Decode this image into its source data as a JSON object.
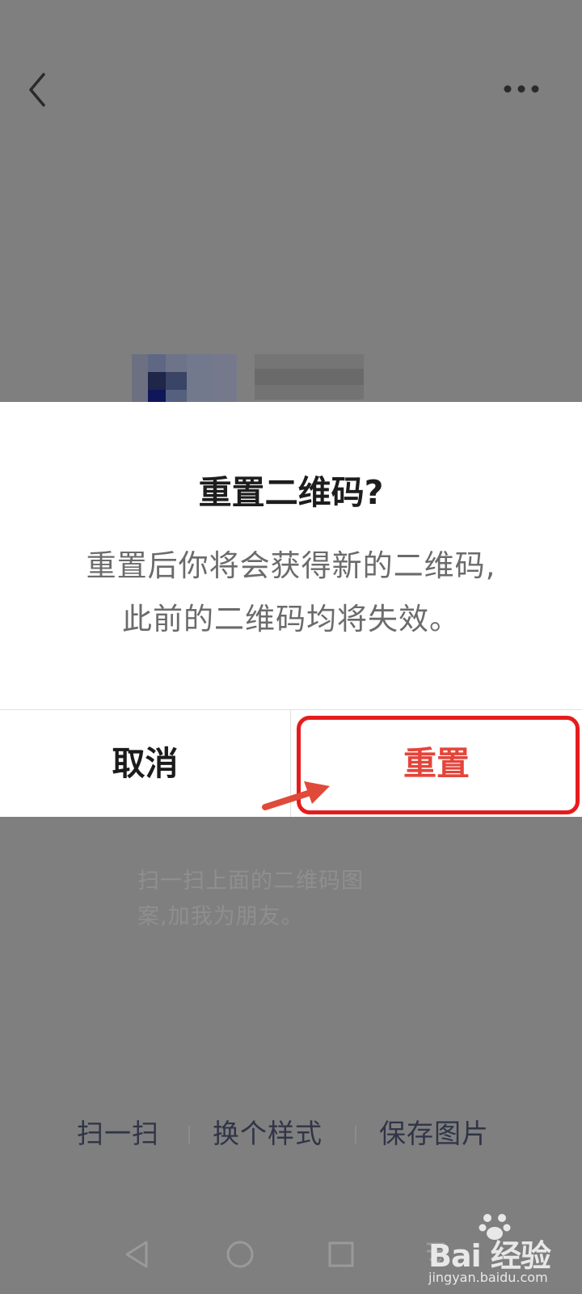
{
  "dialog": {
    "title": "重置二维码?",
    "message_line1": "重置后你将会获得新的二维码,",
    "message_line2": "此前的二维码均将失效。",
    "cancel_label": "取消",
    "confirm_label": "重置",
    "confirm_color": "#e5443a",
    "highlight_color": "#e61c1c"
  },
  "background_page": {
    "hint_line1": "扫一扫上面的二维码图",
    "hint_line2": "案,加我为朋友。",
    "actions": [
      "扫一扫",
      "换个样式",
      "保存图片"
    ]
  },
  "navigation": {
    "icons": [
      "back-triangle-icon",
      "home-circle-icon",
      "recents-square-icon",
      "notification-pull-icon"
    ]
  },
  "watermark": {
    "logo_text": "Bai 经验",
    "url": "jingyan.baidu.com"
  }
}
